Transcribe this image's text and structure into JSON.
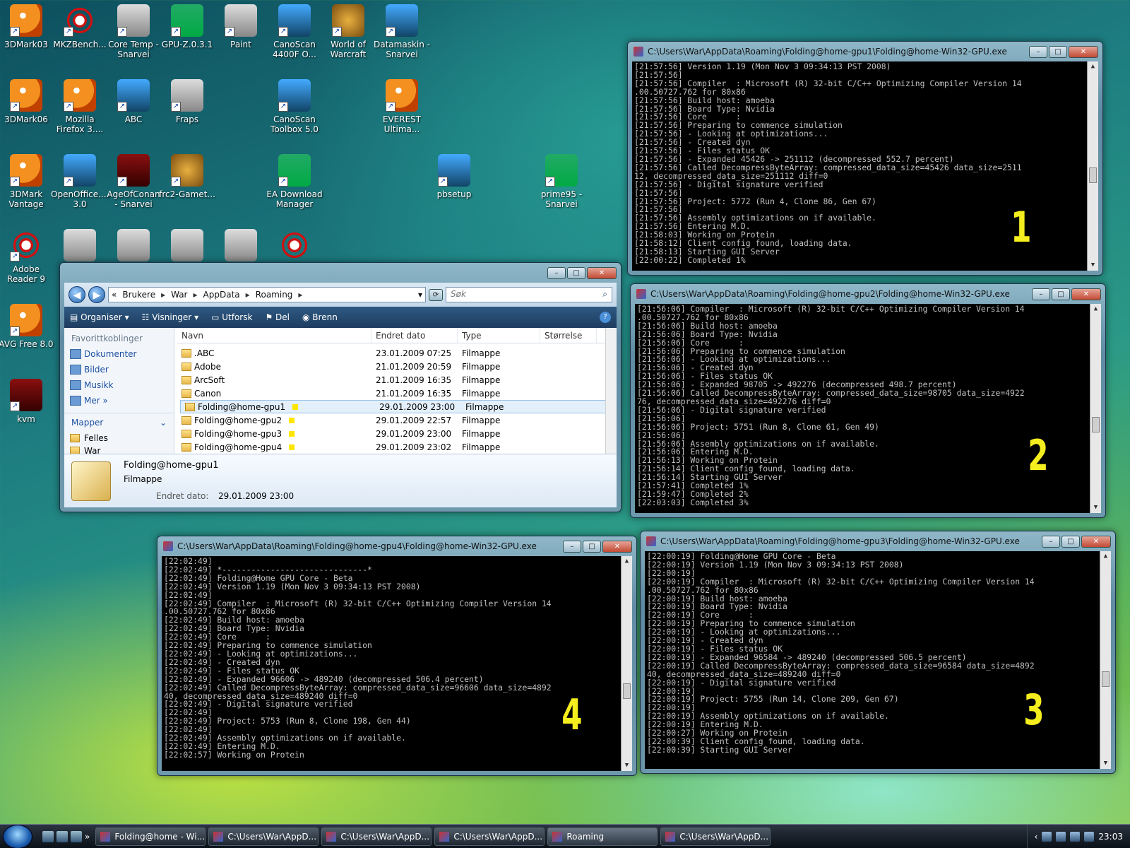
{
  "desktop_icons": [
    {
      "label": "3DMark03",
      "style": "d-orange"
    },
    {
      "label": "MKZBench...",
      "style": "d-red"
    },
    {
      "label": "Core Temp - Snarvei",
      "style": "d-gray"
    },
    {
      "label": "GPU-Z.0.3.1",
      "style": "d-green"
    },
    {
      "label": "Paint",
      "style": "d-gray"
    },
    {
      "label": "CanoScan 4400F O...",
      "style": "d-blue"
    },
    {
      "label": "World of Warcraft",
      "style": "d-gold"
    },
    {
      "label": "Datamaskin - Snarvei",
      "style": "d-blue"
    },
    {
      "label": "3DMark06",
      "style": "d-orange"
    },
    {
      "label": "Mozilla Firefox 3....",
      "style": "d-orange"
    },
    {
      "label": "ABC",
      "style": "d-blue"
    },
    {
      "label": "Fraps",
      "style": "d-gray"
    },
    {
      "label": "CanoScan Toolbox 5.0",
      "style": "d-blue"
    },
    {
      "label": "EVEREST Ultima...",
      "style": "d-orange"
    },
    {
      "label": "3DMark Vantage",
      "style": "d-orange"
    },
    {
      "label": "OpenOffice.... 3.0",
      "style": "d-blue"
    },
    {
      "label": "AgeOfConan - Snarvei",
      "style": "d-dark"
    },
    {
      "label": "frc2-Gamet...",
      "style": "d-gold"
    },
    {
      "label": "EA Download Manager",
      "style": "d-green"
    },
    {
      "label": "pbsetup",
      "style": "d-blue"
    },
    {
      "label": "prime95 - Snarvei",
      "style": "d-green"
    },
    {
      "label": "Adobe Reader 9",
      "style": "d-red"
    },
    {
      "label": "AVG Free 8.0",
      "style": "d-orange"
    },
    {
      "label": "kvm",
      "style": "d-dark"
    }
  ],
  "consoles": [
    {
      "title": "C:\\Users\\War\\AppData\\Roaming\\Folding@home-gpu1\\Folding@home-Win32-GPU.exe",
      "number": "1",
      "text": "[21:57:56] Version 1.19 (Mon Nov 3 09:34:13 PST 2008)\n[21:57:56]\n[21:57:56] Compiler  : Microsoft (R) 32-bit C/C++ Optimizing Compiler Version 14\n.00.50727.762 for 80x86\n[21:57:56] Build host: amoeba\n[21:57:56] Board Type: Nvidia\n[21:57:56] Core      :\n[21:57:56] Preparing to commence simulation\n[21:57:56] - Looking at optimizations...\n[21:57:56] - Created dyn\n[21:57:56] - Files status OK\n[21:57:56] - Expanded 45426 -> 251112 (decompressed 552.7 percent)\n[21:57:56] Called DecompressByteArray: compressed_data_size=45426 data_size=2511\n12, decompressed_data_size=251112 diff=0\n[21:57:56] - Digital signature verified\n[21:57:56]\n[21:57:56] Project: 5772 (Run 4, Clone 86, Gen 67)\n[21:57:56]\n[21:57:56] Assembly optimizations on if available.\n[21:57:56] Entering M.D.\n[21:58:03] Working on Protein\n[21:58:12] Client config found, loading data.\n[21:58:13] Starting GUI Server\n[22:00:22] Completed 1%"
    },
    {
      "title": "C:\\Users\\War\\AppData\\Roaming\\Folding@home-gpu2\\Folding@home-Win32-GPU.exe",
      "number": "2",
      "text": "[21:56:06] Compiler  : Microsoft (R) 32-bit C/C++ Optimizing Compiler Version 14\n.00.50727.762 for 80x86\n[21:56:06] Build host: amoeba\n[21:56:06] Board Type: Nvidia\n[21:56:06] Core      :\n[21:56:06] Preparing to commence simulation\n[21:56:06] - Looking at optimizations...\n[21:56:06] - Created dyn\n[21:56:06] - Files status OK\n[21:56:06] - Expanded 98705 -> 492276 (decompressed 498.7 percent)\n[21:56:06] Called DecompressByteArray: compressed_data_size=98705 data_size=4922\n76, decompressed_data_size=492276 diff=0\n[21:56:06] - Digital signature verified\n[21:56:06]\n[21:56:06] Project: 5751 (Run 8, Clone 61, Gen 49)\n[21:56:06]\n[21:56:06] Assembly optimizations on if available.\n[21:56:06] Entering M.D.\n[21:56:13] Working on Protein\n[21:56:14] Client config found, loading data.\n[21:56:14] Starting GUI Server\n[21:57:41] Completed 1%\n[21:59:47] Completed 2%\n[22:03:03] Completed 3%"
    },
    {
      "title": "C:\\Users\\War\\AppData\\Roaming\\Folding@home-gpu3\\Folding@home-Win32-GPU.exe",
      "number": "3",
      "text": "[22:00:19] Folding@Home GPU Core - Beta\n[22:00:19] Version 1.19 (Mon Nov 3 09:34:13 PST 2008)\n[22:00:19]\n[22:00:19] Compiler  : Microsoft (R) 32-bit C/C++ Optimizing Compiler Version 14\n.00.50727.762 for 80x86\n[22:00:19] Build host: amoeba\n[22:00:19] Board Type: Nvidia\n[22:00:19] Core      :\n[22:00:19] Preparing to commence simulation\n[22:00:19] - Looking at optimizations...\n[22:00:19] - Created dyn\n[22:00:19] - Files status OK\n[22:00:19] - Expanded 96584 -> 489240 (decompressed 506.5 percent)\n[22:00:19] Called DecompressByteArray: compressed_data_size=96584 data_size=4892\n40, decompressed_data_size=489240 diff=0\n[22:00:19] - Digital signature verified\n[22:00:19]\n[22:00:19] Project: 5755 (Run 14, Clone 209, Gen 67)\n[22:00:19]\n[22:00:19] Assembly optimizations on if available.\n[22:00:19] Entering M.D.\n[22:00:27] Working on Protein\n[22:00:39] Client config found, loading data.\n[22:00:39] Starting GUI Server"
    },
    {
      "title": "C:\\Users\\War\\AppData\\Roaming\\Folding@home-gpu4\\Folding@home-Win32-GPU.exe",
      "number": "4",
      "text": "[22:02:49]\n[22:02:49] *------------------------------*\n[22:02:49] Folding@Home GPU Core - Beta\n[22:02:49] Version 1.19 (Mon Nov 3 09:34:13 PST 2008)\n[22:02:49]\n[22:02:49] Compiler  : Microsoft (R) 32-bit C/C++ Optimizing Compiler Version 14\n.00.50727.762 for 80x86\n[22:02:49] Build host: amoeba\n[22:02:49] Board Type: Nvidia\n[22:02:49] Core      :\n[22:02:49] Preparing to commence simulation\n[22:02:49] - Looking at optimizations...\n[22:02:49] - Created dyn\n[22:02:49] - Files status OK\n[22:02:49] - Expanded 96606 -> 489240 (decompressed 506.4 percent)\n[22:02:49] Called DecompressByteArray: compressed_data_size=96606 data_size=4892\n40, decompressed_data_size=489240 diff=0\n[22:02:49] - Digital signature verified\n[22:02:49]\n[22:02:49] Project: 5753 (Run 8, Clone 198, Gen 44)\n[22:02:49]\n[22:02:49] Assembly optimizations on if available.\n[22:02:49] Entering M.D.\n[22:02:57] Working on Protein"
    }
  ],
  "explorer": {
    "breadcrumb": [
      "«",
      "Brukere",
      "War",
      "AppData",
      "Roaming"
    ],
    "search_placeholder": "Søk",
    "toolbar": {
      "organise": "Organiser",
      "views": "Visninger",
      "explore": "Utforsk",
      "share": "Del",
      "burn": "Brenn"
    },
    "nav": {
      "fav_header": "Favorittkoblinger",
      "links": [
        "Dokumenter",
        "Bilder",
        "Musikk"
      ],
      "more": "Mer",
      "folders_header": "Mapper",
      "tree": [
        "Felles",
        "War"
      ]
    },
    "columns": {
      "name": "Navn",
      "date": "Endret dato",
      "type": "Type",
      "size": "Størrelse"
    },
    "files": [
      {
        "name": ".ABC",
        "date": "23.01.2009 07:25",
        "type": "Filmappe",
        "marked": false
      },
      {
        "name": "Adobe",
        "date": "21.01.2009 20:59",
        "type": "Filmappe",
        "marked": false
      },
      {
        "name": "ArcSoft",
        "date": "21.01.2009 16:35",
        "type": "Filmappe",
        "marked": false
      },
      {
        "name": "Canon",
        "date": "21.01.2009 16:35",
        "type": "Filmappe",
        "marked": false
      },
      {
        "name": "Folding@home-gpu1",
        "date": "29.01.2009 23:00",
        "type": "Filmappe",
        "marked": true
      },
      {
        "name": "Folding@home-gpu2",
        "date": "29.01.2009 22:57",
        "type": "Filmappe",
        "marked": true
      },
      {
        "name": "Folding@home-gpu3",
        "date": "29.01.2009 23:00",
        "type": "Filmappe",
        "marked": true
      },
      {
        "name": "Folding@home-gpu4",
        "date": "29.01.2009 23:02",
        "type": "Filmappe",
        "marked": true
      }
    ],
    "selected_index": 4,
    "details": {
      "name": "Folding@home-gpu1",
      "type": "Filmappe",
      "date_label": "Endret dato:",
      "date": "29.01.2009 23:00"
    }
  },
  "taskbar": {
    "buttons": [
      {
        "label": "Folding@home - Wi...",
        "active": false
      },
      {
        "label": "C:\\Users\\War\\AppD...",
        "active": false
      },
      {
        "label": "C:\\Users\\War\\AppD...",
        "active": false
      },
      {
        "label": "C:\\Users\\War\\AppD...",
        "active": false
      },
      {
        "label": "Roaming",
        "active": true
      },
      {
        "label": "C:\\Users\\War\\AppD...",
        "active": false
      }
    ],
    "clock": "23:03"
  }
}
